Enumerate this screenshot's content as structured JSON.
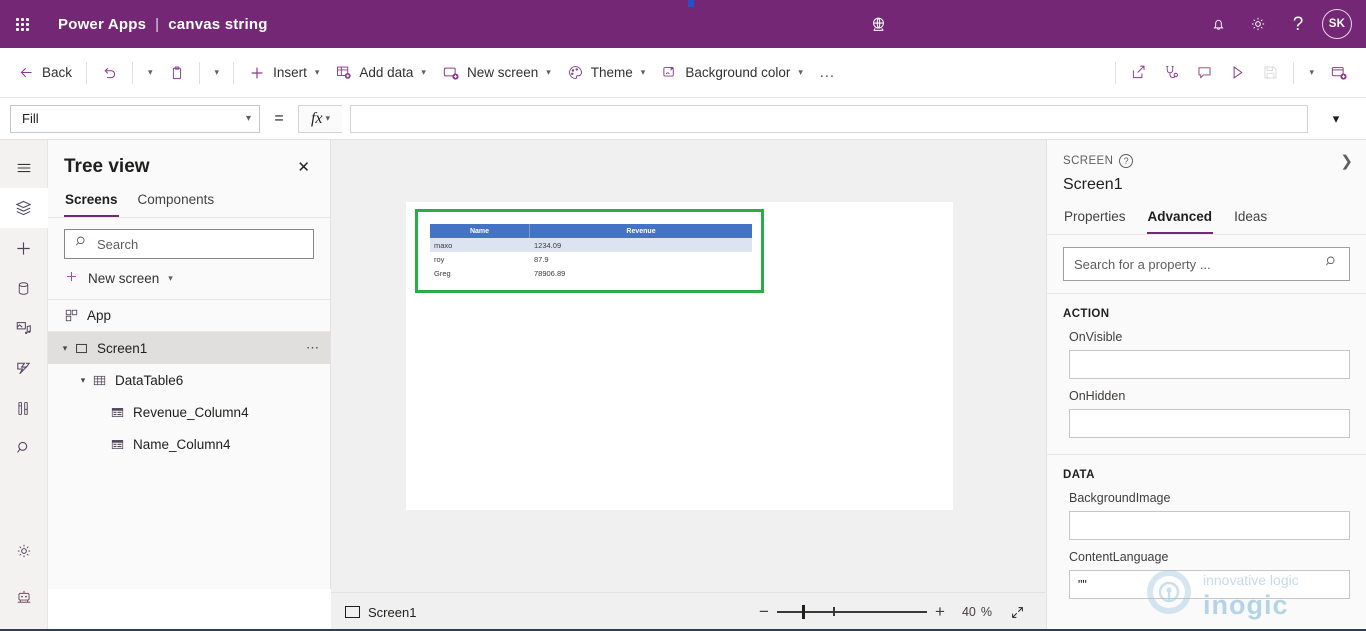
{
  "topbar": {
    "waffle_label": "app-launcher",
    "brand": "Power Apps",
    "separator": "|",
    "app_name": "canvas string",
    "env_icon": "environment-icon",
    "notifications_icon": "bell-icon",
    "settings_icon": "gear-icon",
    "help_icon": "question-icon",
    "avatar_initials": "SK",
    "bg_color": "#742774"
  },
  "commandbar": {
    "back": "Back",
    "undo": "undo-icon",
    "undo_chevron": "chevron-down-icon",
    "paste": "paste-icon",
    "paste_chevron": "chevron-down-icon",
    "insert": "Insert",
    "add_data": "Add data",
    "new_screen": "New screen",
    "theme": "Theme",
    "background_color": "Background color",
    "overflow": "…",
    "share": "share-icon",
    "app_checker": "app-checker-icon",
    "comments": "comment-icon",
    "preview": "play-icon",
    "save": "save-icon",
    "save_chevron": "chevron-down-icon",
    "publish": "publish-icon"
  },
  "formulabar": {
    "property": "Fill",
    "property_chevron": "chevron-down-icon",
    "equals": "=",
    "fx_label": "fx",
    "fx_chevron": "chevron-down-icon",
    "formula_value": "",
    "formula_placeholder": "",
    "expand_chevron": "chevron-down-icon"
  },
  "rail": {
    "items": [
      {
        "name": "hamburger-menu-icon",
        "active": false
      },
      {
        "name": "tree-view-icon",
        "active": true
      },
      {
        "name": "insert-icon",
        "active": false
      },
      {
        "name": "data-icon",
        "active": false
      },
      {
        "name": "media-icon",
        "active": false
      },
      {
        "name": "power-automate-icon",
        "active": false
      },
      {
        "name": "variables-icon",
        "active": false
      },
      {
        "name": "search-icon",
        "active": false
      }
    ],
    "bottom_items": [
      {
        "name": "settings-gear-icon"
      },
      {
        "name": "copilot-robot-icon"
      }
    ]
  },
  "treeview": {
    "title": "Tree view",
    "close_icon": "close-icon",
    "tabs": [
      {
        "label": "Screens",
        "selected": true
      },
      {
        "label": "Components",
        "selected": false
      }
    ],
    "search_placeholder": "Search",
    "search_value": "",
    "new_screen": "New screen",
    "nodes": [
      {
        "label": "App",
        "icon": "app-icon",
        "indent": 0,
        "caret": "",
        "selected": false,
        "more": false
      },
      {
        "label": "Screen1",
        "icon": "screen-icon",
        "indent": 0,
        "caret": "⌄",
        "selected": true,
        "more": true
      },
      {
        "label": "DataTable6",
        "icon": "datatable-icon",
        "indent": 1,
        "caret": "⌄",
        "selected": false,
        "more": false
      },
      {
        "label": "Revenue_Column4",
        "icon": "column-icon",
        "indent": 2,
        "caret": "",
        "selected": false,
        "more": false
      },
      {
        "label": "Name_Column4",
        "icon": "column-icon",
        "indent": 2,
        "caret": "",
        "selected": false,
        "more": false
      }
    ]
  },
  "canvas": {
    "selection_color": "#2eaa4e",
    "datatable": {
      "header_color": "#4472c4",
      "columns": [
        "Name",
        "Revenue"
      ],
      "rows": [
        {
          "Name": "maxo",
          "Revenue": "1234.09",
          "alt": true
        },
        {
          "Name": "roy",
          "Revenue": "87.9",
          "alt": false
        },
        {
          "Name": "Greg",
          "Revenue": "78906.89",
          "alt": false
        }
      ]
    }
  },
  "statusbar": {
    "screen_label": "Screen1",
    "zoom_out": "−",
    "zoom_in": "+",
    "zoom_value": "40",
    "zoom_unit": "%",
    "fit_icon": "fit-to-screen-icon"
  },
  "properties": {
    "kicker": "SCREEN",
    "help_icon": "question-icon",
    "collapse_icon": "chevron-right-icon",
    "name": "Screen1",
    "tabs": [
      {
        "label": "Properties",
        "selected": false
      },
      {
        "label": "Advanced",
        "selected": true
      },
      {
        "label": "Ideas",
        "selected": false
      }
    ],
    "search_placeholder": "Search for a property ...",
    "search_value": "",
    "search_icon": "search-icon",
    "sections": [
      {
        "title": "ACTION",
        "fields": [
          {
            "label": "OnVisible",
            "value": ""
          },
          {
            "label": "OnHidden",
            "value": ""
          }
        ]
      },
      {
        "title": "DATA",
        "fields": [
          {
            "label": "BackgroundImage",
            "value": ""
          },
          {
            "label": "ContentLanguage",
            "value": "\"\""
          }
        ]
      }
    ]
  },
  "watermark": {
    "line1": "innovative logic",
    "line2": "inogic"
  }
}
